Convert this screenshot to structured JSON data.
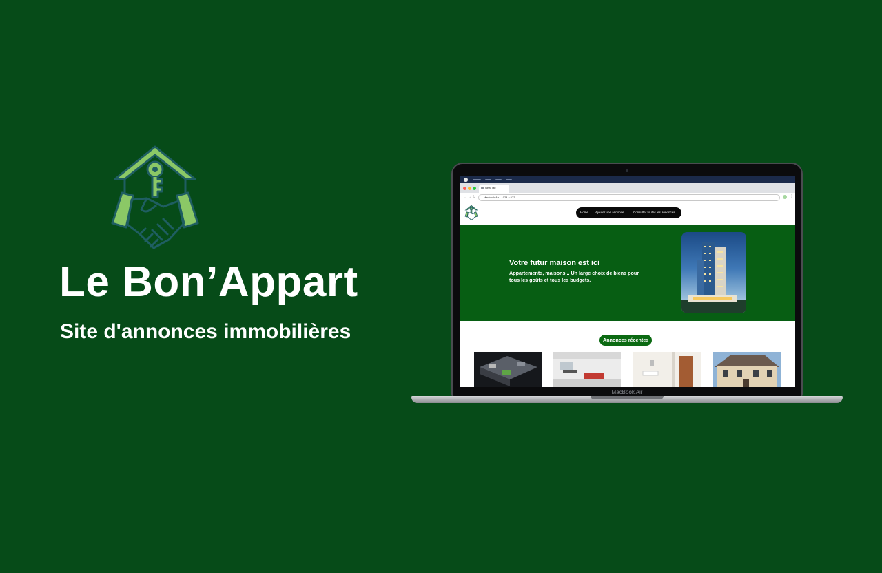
{
  "brand": {
    "title": "Le Bon’Appart",
    "subtitle": "Site d'annonces immobilières"
  },
  "colors": {
    "background": "#064b18",
    "hero": "#075e13",
    "accent_light": "#8bc866",
    "accent_dark": "#1f5e62",
    "nav_bg": "#0a0a0a"
  },
  "laptop": {
    "chin_label": "MacBook Air"
  },
  "browser": {
    "tab_label": "New Tab",
    "address": "Macbook Air · 1024 x 572"
  },
  "site": {
    "nav": {
      "home": "Home",
      "add_listing": "Ajouter une annonce",
      "all_listings": "Consulter toutes les annonces"
    },
    "hero": {
      "title": "Votre futur maison est ici",
      "text": "Appartements, maisons... Un large choix de biens pour tous les goûts et tous les budgets."
    },
    "recent": {
      "label": "Annonces récentes",
      "cards": [
        "apartment-3d-plan",
        "living-room",
        "kitchen-door",
        "house-facade"
      ]
    }
  }
}
